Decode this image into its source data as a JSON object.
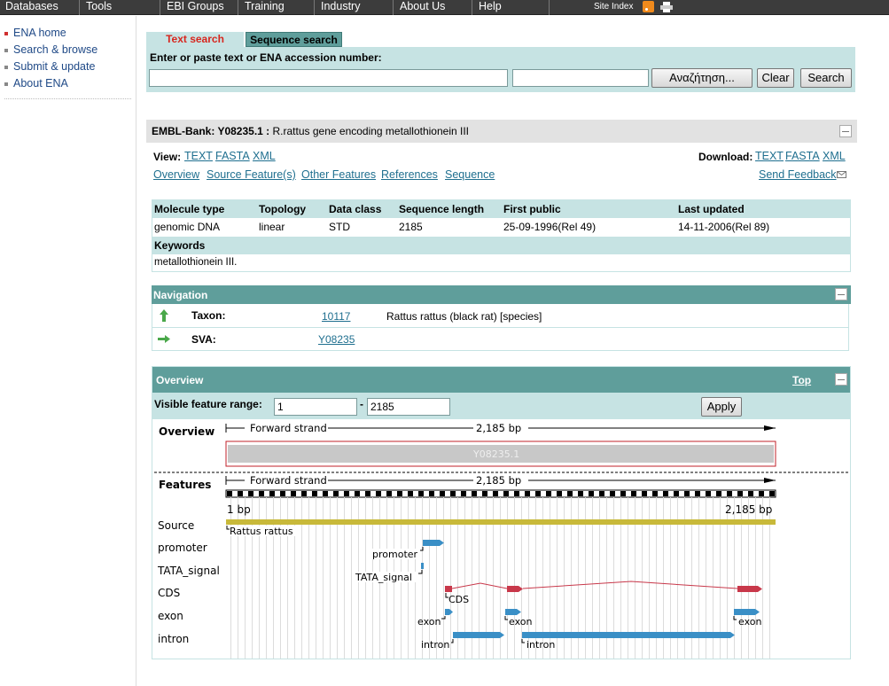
{
  "topnav": {
    "items": [
      "Databases",
      "Tools",
      "EBI Groups",
      "Training",
      "Industry",
      "About Us",
      "Help"
    ],
    "site_index": "Site Index"
  },
  "leftnav": {
    "items": [
      "ENA home",
      "Search & browse",
      "Submit & update",
      "About ENA"
    ]
  },
  "search": {
    "tab_text": "Text search",
    "tab_sequence": "Sequence search",
    "label": "Enter or paste text or ENA accession number:",
    "query_value": "",
    "file_value": "",
    "browse_label": "Αναζήτηση...",
    "clear_label": "Clear",
    "search_label": "Search"
  },
  "entry": {
    "db_accession": "EMBL-Bank: Y08235.1 :",
    "description": "R.rattus gene encoding metallothionein III",
    "view_label": "View:",
    "view_formats": [
      "TEXT",
      "FASTA",
      "XML"
    ],
    "download_label": "Download:",
    "download_formats": [
      "TEXT",
      "FASTA",
      "XML"
    ],
    "section_links": [
      "Overview",
      "Source Feature(s)",
      "Other Features",
      "References",
      "Sequence"
    ],
    "feedback": "Send Feedback"
  },
  "info": {
    "headers": [
      "Molecule type",
      "Topology",
      "Data class",
      "Sequence length",
      "First public",
      "Last updated"
    ],
    "values": [
      "genomic DNA",
      "linear",
      "STD",
      "2185",
      "25-09-1996(Rel 49)",
      "14-11-2006(Rel 89)"
    ],
    "keywords_label": "Keywords",
    "keywords": "metallothionein III."
  },
  "navigation": {
    "title": "Navigation",
    "taxon_label": "Taxon:",
    "taxon_id": "10117",
    "taxon_name": "Rattus rattus (black rat) [species]",
    "sva_label": "SVA:",
    "sva_id": "Y08235"
  },
  "overview": {
    "title": "Overview",
    "top_link": "Top",
    "range_label": "Visible feature range:",
    "range_from": "1",
    "range_separator": "-",
    "range_to": "2185",
    "apply_label": "Apply",
    "overview_label": "Overview",
    "features_label": "Features",
    "strand_label": "Forward strand",
    "length_label": "2,185 bp",
    "sequence_name": "Y08235.1",
    "start_label": "1 bp",
    "end_label": "2,185 bp",
    "track_labels": [
      "Source",
      "promoter",
      "TATA_signal",
      "CDS",
      "exon",
      "intron"
    ],
    "feature_labels": {
      "source": "Rattus rattus",
      "promoter": "promoter",
      "tata": "TATA_signal",
      "cds": "CDS",
      "exon": "exon",
      "intron": "intron"
    },
    "colors": {
      "source": "#c8b93a",
      "feature": "#3a8fc6",
      "cds": "#c8384a",
      "sequence_box": "#c8c8c8",
      "sequence_border": "#c0202a"
    }
  }
}
